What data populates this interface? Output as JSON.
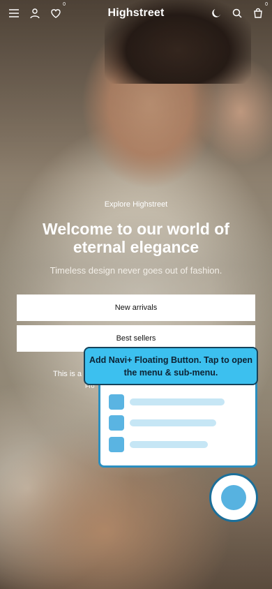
{
  "header": {
    "brand": "Highstreet",
    "wishlist_count": "0",
    "cart_count": "0"
  },
  "hero": {
    "eyebrow": "Explore Highstreet",
    "headline": "Welcome to our world of eternal elegance",
    "subline": "Timeless design never goes out of fashion.",
    "cta_primary": "New arrivals",
    "cta_secondary": "Best sellers",
    "partial_text": "This is a",
    "partial_text2": "Fro"
  },
  "navi_promo": {
    "tooltip": "Add Navi+ Floating Button. Tap to open the menu & sub-menu.",
    "accent": "#3cc0ef",
    "menu_items": [
      {},
      {},
      {}
    ]
  }
}
